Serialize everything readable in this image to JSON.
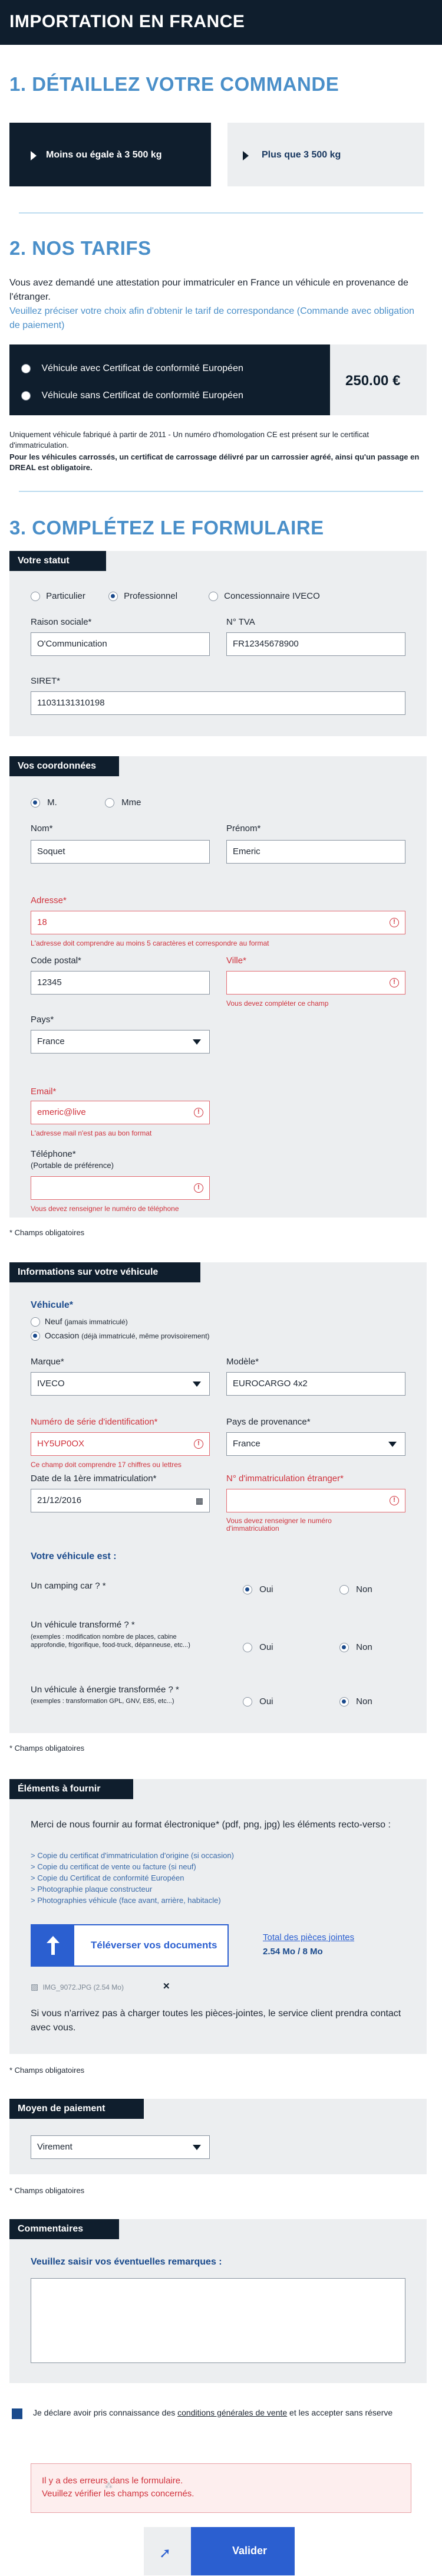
{
  "header": {
    "title": "IMPORTATION EN FRANCE"
  },
  "step1": {
    "title": "1. DÉTAILLEZ VOTRE COMMANDE",
    "option_a": "Moins ou égale à 3 500 kg",
    "option_b": "Plus que 3 500 kg"
  },
  "step2": {
    "title": "2. NOS TARIFS",
    "intro": "Vous avez demandé une attestation pour immatriculer en France un véhicule en provenance de l'étranger.",
    "intro_blue": "Veuillez préciser votre choix afin d'obtenir le tarif de correspondance (Commande avec obligation de paiement)",
    "opt_with_cert": "Véhicule avec Certificat de conformité Européen",
    "opt_without_cert": "Véhicule sans Certificat de conformité Européen",
    "price": "250.00 €",
    "note1": "Uniquement véhicule fabriqué à partir de 2011 - Un numéro d'homologation CE est présent sur le certificat d'immatriculation.",
    "note2": "Pour les véhicules carrossés, un certificat de carrossage délivré par un carrossier agréé, ainsi qu'un passage en DREAL est obligatoire."
  },
  "step3": {
    "title": "3. COMPLÉTEZ LE FORMULAIRE"
  },
  "statut": {
    "head": "Votre statut",
    "opt_particulier": "Particulier",
    "opt_professionnel": "Professionnel",
    "opt_concessionnaire": "Concessionnaire IVECO",
    "raison_label": "Raison sociale*",
    "raison_value": "O'Communication",
    "tva_label": "N° TVA",
    "tva_value": "FR12345678900",
    "siret_label": "SIRET*",
    "siret_value": "11031131310198"
  },
  "coordonnees": {
    "head": "Vos coordonnées",
    "civ_m": "M.",
    "civ_mme": "Mme",
    "nom_label": "Nom*",
    "nom_value": "Soquet",
    "prenom_label": "Prénom*",
    "prenom_value": "Emeric",
    "adresse_label": "Adresse*",
    "adresse_value": "18",
    "adresse_error": "L'adresse doit comprendre au moins 5 caractères et correspondre au format",
    "cp_label": "Code postal*",
    "cp_value": "12345",
    "ville_label": "Ville*",
    "ville_error": "Vous devez compléter ce champ",
    "pays_label": "Pays*",
    "pays_value": "France",
    "email_label": "Email*",
    "email_value": "emeric@live",
    "email_error": "L'adresse mail n'est pas au bon format",
    "tel_label": "Téléphone*",
    "tel_sub": "(Portable de préférence)",
    "tel_error": "Vous devez renseigner le numéro de téléphone"
  },
  "required_note": "* Champs obligatoires",
  "vehicule": {
    "head": "Informations sur votre véhicule",
    "sub": "Véhicule*",
    "opt_neuf": "Neuf",
    "opt_neuf_hint": "(jamais immatriculé)",
    "opt_occasion": "Occasion",
    "opt_occasion_hint": "(déjà immatriculé, même provisoirement)",
    "marque_label": "Marque*",
    "marque_value": "IVECO",
    "modele_label": "Modèle*",
    "modele_value": "EUROCARGO 4x2",
    "serie_label": "Numéro de série d'identification*",
    "serie_value": "HY5UP0OX",
    "serie_error": "Ce champ doit comprendre 17 chiffres ou lettres",
    "provenance_label": "Pays de provenance*",
    "provenance_value": "France",
    "date_label": "Date de la 1ère immatriculation*",
    "date_value": "21/12/2016",
    "immat_label": "N° d'immatriculation étranger*",
    "immat_error": "Vous devez renseigner le numéro d'immatriculation",
    "est_head": "Votre véhicule est :",
    "q_camping": "Un camping car ? *",
    "q_transforme": "Un véhicule transformé ? *",
    "q_transforme_hint": "(exemples : modification nombre de places, cabine approfondie, frigorifique, food-truck, dépanneuse, etc...)",
    "q_energie": "Un véhicule à énergie transformée ? *",
    "q_energie_hint": "(exemples : transformation GPL, GNV, E85, etc...)",
    "oui": "Oui",
    "non": "Non"
  },
  "elements": {
    "head": "Éléments à fournir",
    "intro": "Merci de nous fournir au format électronique* (pdf, png, jpg) les éléments recto-verso :",
    "items": [
      "> Copie du certificat d'immatriculation d'origine (si occasion)",
      "> Copie du certificat de vente ou facture (si neuf)",
      "> Copie du Certificat de conformité Européen",
      "> Photographie plaque constructeur",
      "> Photographies véhicule (face avant, arrière, habitacle)"
    ],
    "upload_label": "Téléverser vos documents",
    "total_label": "Total des pièces jointes",
    "total_value": "2.54 Mo / 8 Mo",
    "file_name": "IMG_9072.JPG (2.54 Mo)",
    "remove": "✕",
    "help": "Si vous n'arrivez pas à charger toutes les pièces-jointes, le service client prendra contact avec vous."
  },
  "paiement": {
    "head": "Moyen de paiement",
    "value": "Virement"
  },
  "commentaires": {
    "head": "Commentaires",
    "prompt": "Veuillez saisir vos éventuelles remarques :"
  },
  "cgv": {
    "before": "Je déclare avoir pris connaissance des ",
    "link": "conditions générales de vente",
    "after": " et les accepter sans réserve"
  },
  "errors": {
    "line1": "Il y a des erreurs dans le formulaire.",
    "line2": "Veuillez vérifier les champs concernés."
  },
  "submit": {
    "label": "Valider"
  },
  "colors": {
    "navy": "#0f1e2d",
    "accent": "#4a8fc9",
    "button": "#2b5fd0",
    "error": "#d0323c",
    "panel": "#eceef0"
  }
}
